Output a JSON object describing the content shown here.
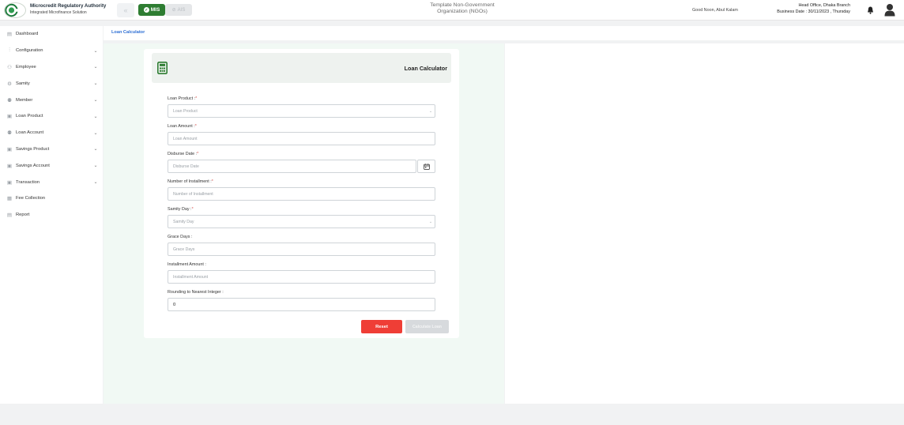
{
  "header": {
    "brand_title": "Microcredit Regulatory Authority",
    "brand_subtitle": "Integrated Microfinance Solution",
    "mis_label": "MIS",
    "ais_label": "AIS",
    "org_line1": "Template Non-Government",
    "org_line2": "Organization (NGOs)",
    "greeting": "Good Noon, Abul Kalam",
    "branch": "Head Office, Dhaka Branch",
    "business_date": "Business Date : 30/11/2023 , Thursday",
    "colors": {
      "mis": "#2e7d32",
      "link": "#2e6fd4",
      "reset": "#ef3e36"
    }
  },
  "sidebar": {
    "items": [
      {
        "label": "Dashboard",
        "icon": "dashboard-icon",
        "has_children": false
      },
      {
        "label": "Configuration",
        "icon": "configuration-icon",
        "has_children": true
      },
      {
        "label": "Employee",
        "icon": "employee-icon",
        "has_children": true
      },
      {
        "label": "Samity",
        "icon": "samity-icon",
        "has_children": true
      },
      {
        "label": "Member",
        "icon": "member-icon",
        "has_children": true
      },
      {
        "label": "Loan Product",
        "icon": "loan-product-icon",
        "has_children": true
      },
      {
        "label": "Loan Account",
        "icon": "loan-account-icon",
        "has_children": true
      },
      {
        "label": "Savings Product",
        "icon": "savings-product-icon",
        "has_children": true
      },
      {
        "label": "Savings Account",
        "icon": "savings-account-icon",
        "has_children": true
      },
      {
        "label": "Transaction",
        "icon": "transaction-icon",
        "has_children": true
      },
      {
        "label": "Fee Collection",
        "icon": "fee-collection-icon",
        "has_children": false
      },
      {
        "label": "Report",
        "icon": "report-icon",
        "has_children": false
      }
    ]
  },
  "breadcrumb": {
    "current": "Loan Calculator"
  },
  "form": {
    "title": "Loan Calculator",
    "fields": [
      {
        "label": "Loan Product :",
        "required": "*",
        "placeholder": "Loan Product",
        "type": "select"
      },
      {
        "label": "Loan Amount :",
        "required": "*",
        "placeholder": "Loan Amount",
        "type": "text"
      },
      {
        "label": "Disburse Date :",
        "required": "*",
        "placeholder": "Disburse Date",
        "type": "date"
      },
      {
        "label": "Number of Installment :",
        "required": "*",
        "placeholder": "Number of Installment",
        "type": "text"
      },
      {
        "label": "Samity Day :",
        "required": "*",
        "placeholder": "Samity Day",
        "type": "select"
      },
      {
        "label": "Grace Days :",
        "required": "",
        "placeholder": "Grace Days",
        "type": "text"
      },
      {
        "label": "Installment Amount :",
        "required": "",
        "placeholder": "Installment Amount",
        "type": "text"
      },
      {
        "label": "Rounding to Nearest Integer :",
        "required": "",
        "value": "0",
        "type": "text"
      }
    ],
    "reset_label": "Reset",
    "calculate_label": "Calculate Loan"
  }
}
